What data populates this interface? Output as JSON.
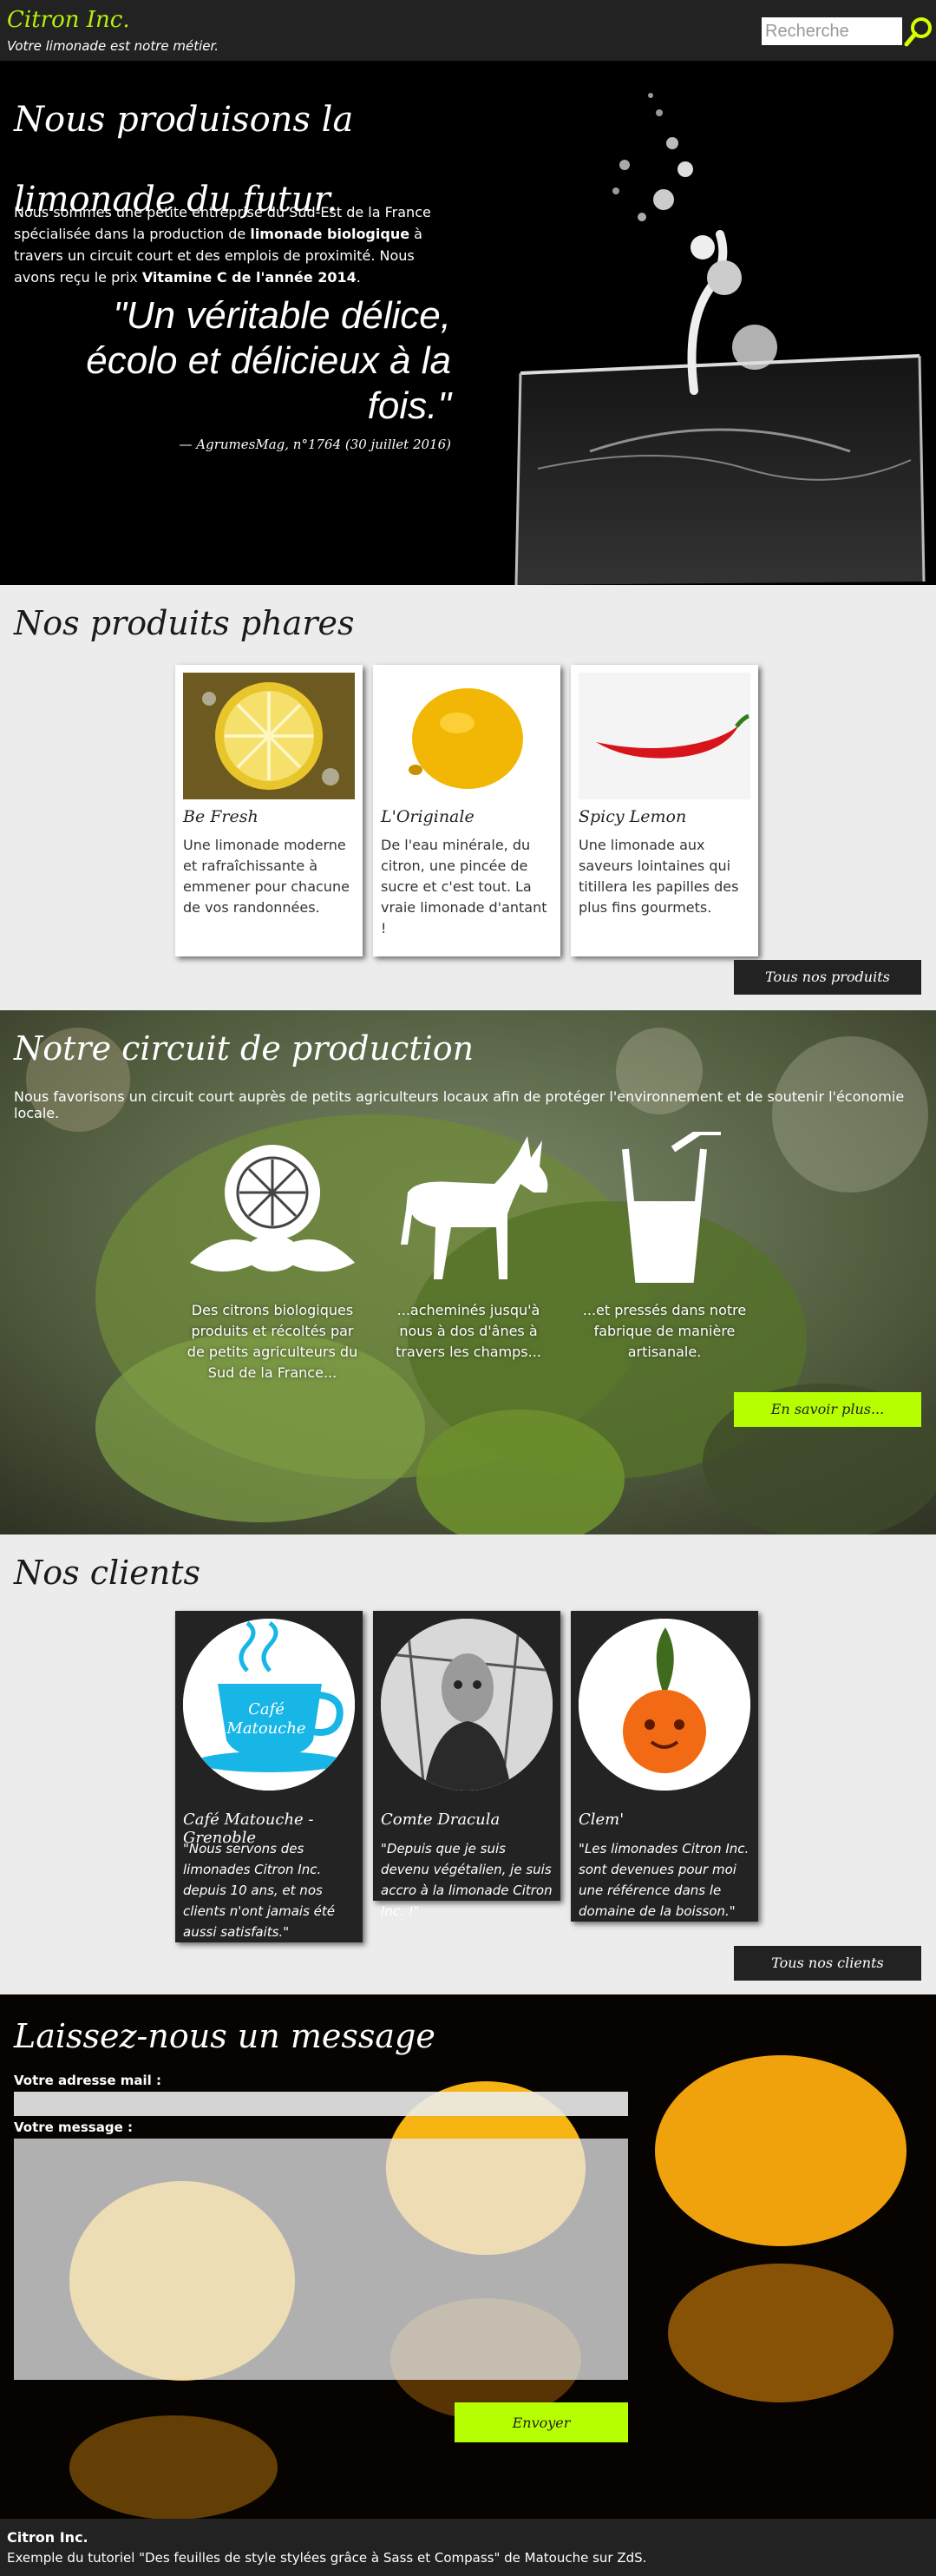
{
  "header": {
    "brand": "Citron Inc.",
    "tagline": "Votre limonade est notre métier.",
    "search_placeholder": "Recherche",
    "accent_color": "#b6f00a"
  },
  "hero": {
    "title": "Nous produisons la limonade du futur.",
    "text_1": "Nous sommes une petite entreprise du Sud-Est de la France spécialisée dans la production de ",
    "text_bold_1": "limonade biologique",
    "text_2": " à travers un circuit court et des emplois de proximité. Nous avons reçu le prix ",
    "text_bold_2": "Vitamine C de l'année 2014",
    "text_3": ".",
    "quote": "\"Un véritable délice, écolo et délicieux à la fois.\"",
    "cite": "— AgrumesMag, n°1764 (30 juillet 2016)"
  },
  "products": {
    "title": "Nos produits phares",
    "items": [
      {
        "name": "Be Fresh",
        "desc": "Une limonade moderne et rafraîchissante à emmener pour chacune de vos randonnées.",
        "image": "lemon-slice-water"
      },
      {
        "name": "L'Originale",
        "desc": "De l'eau minérale, du citron, une pincée de sucre et c'est tout. La vraie limonade d'antant !",
        "image": "whole-lemon"
      },
      {
        "name": "Spicy Lemon",
        "desc": "Une limonade aux saveurs lointaines qui titillera les papilles des plus fins gourmets.",
        "image": "red-chili-pepper"
      }
    ],
    "button": "Tous nos produits"
  },
  "production": {
    "title": "Notre circuit de production",
    "intro": "Nous favorisons un circuit court auprès de petits agriculteurs locaux afin de protéger l'environnement et de soutenir l'économie locale.",
    "steps": [
      {
        "icon": "lemon-icon",
        "text": "Des citrons biologiques produits et récoltés par de petits agriculteurs du Sud de la France..."
      },
      {
        "icon": "donkey-icon",
        "text": "...acheminés jusqu'à nous à dos d'ânes à travers les champs..."
      },
      {
        "icon": "glass-icon",
        "text": "...et pressés dans notre fabrique de manière artisanale."
      }
    ],
    "button": "En savoir plus..."
  },
  "clients": {
    "title": "Nos clients",
    "items": [
      {
        "name": "Café Matouche - Grenoble",
        "quote": "\"Nous servons des limonades Citron Inc. depuis 10 ans, et nos clients n'ont jamais été aussi satisfaits.\"",
        "logo_text_1": "Café",
        "logo_text_2": "Matouche"
      },
      {
        "name": "Comte Dracula",
        "quote": "\"Depuis que je suis devenu végétalien, je suis accro à la limonade Citron Inc. !\""
      },
      {
        "name": "Clem'",
        "quote": "\"Les limonades Citron Inc. sont devenues pour moi une référence dans le domaine de la boisson.\""
      }
    ],
    "button": "Tous nos clients"
  },
  "contact": {
    "title": "Laissez-nous un message",
    "mail_label": "Votre adresse mail :",
    "message_label": "Votre message :",
    "submit": "Envoyer"
  },
  "footer": {
    "company": "Citron Inc.",
    "credit": "Exemple du tutoriel \"Des feuilles de style stylées grâce à Sass et Compass\" de Matouche sur ZdS."
  }
}
